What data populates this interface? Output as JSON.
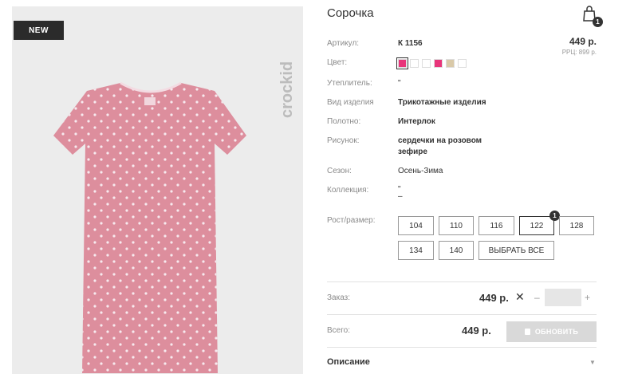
{
  "badge": {
    "new": "NEW"
  },
  "brand": {
    "logo_text": "crockid"
  },
  "product": {
    "title": "Сорочка",
    "price": "449 р.",
    "rrp": "РРЦ: 899 р."
  },
  "cart": {
    "count": "1"
  },
  "fields": {
    "article": {
      "label": "Артикул:",
      "value": "К 1156"
    },
    "color": {
      "label": "Цвет:"
    },
    "insulation": {
      "label": "Утеплитель:",
      "value": "\""
    },
    "product_type": {
      "label": "Вид изделия",
      "value": "Трикотажные изделия"
    },
    "fabric": {
      "label": "Полотно:",
      "value": "Интерлок"
    },
    "pattern": {
      "label": "Рисунок:",
      "value_line1": "сердечки на розовом",
      "value_line2": "зефире"
    },
    "season": {
      "label": "Сезон:",
      "value": "Осень-Зима"
    },
    "collection": {
      "label": "Коллекция:",
      "value_line1": "\"",
      "value_line2": "–"
    }
  },
  "swatches": [
    "#e8357a",
    "#ffffff",
    "#ffffff",
    "#e8357a",
    "#d9c9a8",
    "#ffffff"
  ],
  "sizes": {
    "label": "Рост/размер:",
    "options": [
      "104",
      "110",
      "116",
      "122",
      "128",
      "134",
      "140"
    ],
    "select_all": "ВЫБРАТЬ ВСЕ",
    "selected_count": "1"
  },
  "order": {
    "label": "Заказ:",
    "price": "449 р.",
    "times": "✕",
    "minus": "–",
    "plus": "+",
    "quantity": ""
  },
  "total": {
    "label": "Всего:",
    "price": "449 р.",
    "update_button": "ОБНОВИТЬ"
  },
  "description": {
    "label": "Описание",
    "arrow": "▼"
  },
  "colors": {
    "garment": "#dd8e9d",
    "dot": "#f7e9ee",
    "accent": "#e8357a"
  }
}
